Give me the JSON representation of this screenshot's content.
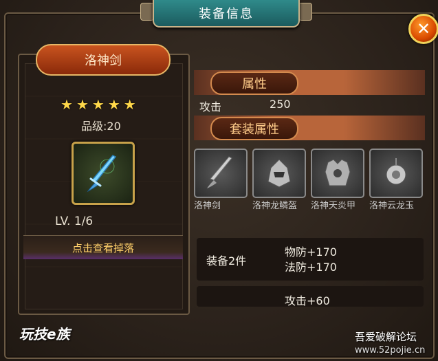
{
  "window": {
    "title": "装备信息"
  },
  "equipment": {
    "name": "洛神剑",
    "stars": 5,
    "grade_text": "品级:20",
    "level_text": "LV. 1/6",
    "view_drop_label": "点击查看掉落",
    "icon": "sword-icon"
  },
  "attributes": {
    "header": "属性",
    "rows": [
      {
        "name": "攻击",
        "value": "250"
      }
    ]
  },
  "set": {
    "header": "套装属性",
    "items": [
      {
        "name": "洛神剑",
        "icon": "sword-icon"
      },
      {
        "name": "洛神龙鳞盔",
        "icon": "helmet-icon"
      },
      {
        "name": "洛神天炎甲",
        "icon": "armor-icon"
      },
      {
        "name": "洛神云龙玉",
        "icon": "jade-icon"
      }
    ],
    "bonuses": [
      {
        "label": "装备2件",
        "values": [
          "物防+170",
          "法防+170"
        ]
      },
      {
        "label": "",
        "values": [
          "攻击+60"
        ]
      }
    ]
  },
  "watermarks": {
    "left": "玩技e族",
    "right": "吾爱破解论坛",
    "right_url": "www.52pojie.cn"
  },
  "colors": {
    "accent": "#2f8a8a",
    "close": "#d94a00",
    "star": "#ffd84a"
  }
}
